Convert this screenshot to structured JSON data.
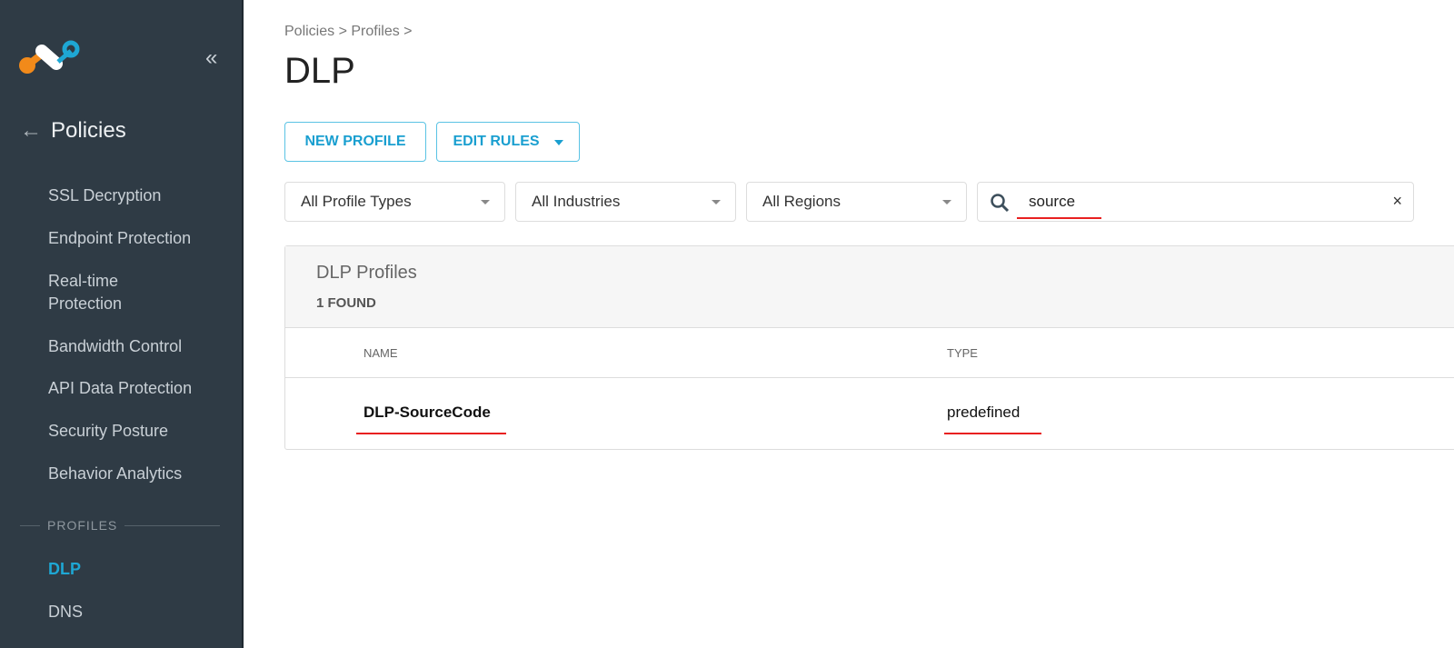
{
  "sidebar": {
    "back_label": "Policies",
    "items": [
      {
        "label": "SSL Decryption"
      },
      {
        "label": "Endpoint Protection"
      },
      {
        "label": "Real-time Protection"
      },
      {
        "label": "Bandwidth Control"
      },
      {
        "label": "API Data Protection"
      },
      {
        "label": "Security Posture"
      },
      {
        "label": "Behavior Analytics"
      }
    ],
    "section": "PROFILES",
    "profile_items": [
      {
        "label": "DLP",
        "active": true
      },
      {
        "label": "DNS"
      }
    ]
  },
  "breadcrumb": "Policies > Profiles >",
  "title": "DLP",
  "toolbar": {
    "new_profile": "NEW PROFILE",
    "edit_rules": "EDIT RULES"
  },
  "filters": {
    "profile_types": "All Profile Types",
    "industries": "All Industries",
    "regions": "All Regions",
    "search_value": "source"
  },
  "table": {
    "title": "DLP Profiles",
    "count": "1 FOUND",
    "columns": [
      "NAME",
      "TYPE"
    ],
    "rows": [
      {
        "name": "DLP-SourceCode",
        "type": "predefined"
      }
    ]
  },
  "colors": {
    "accent": "#1ea7d4",
    "sidebar": "#2f3b45",
    "annotation": "#e82020"
  }
}
